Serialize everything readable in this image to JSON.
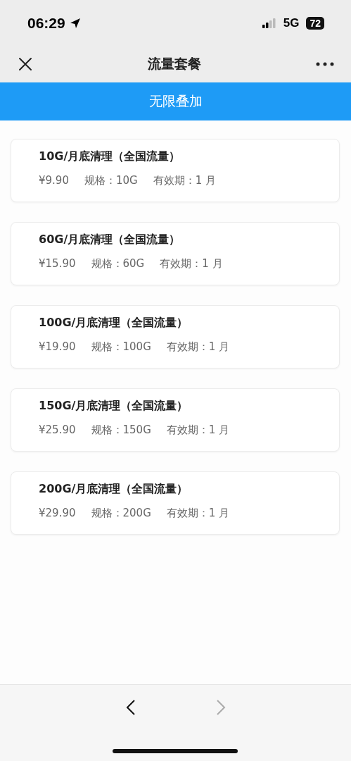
{
  "status_bar": {
    "time": "06:29",
    "network": "5G",
    "battery": "72"
  },
  "nav_bar": {
    "title": "流量套餐"
  },
  "banner": {
    "label": "无限叠加"
  },
  "plans": [
    {
      "title": "10G/月底清理（全国流量）",
      "price": "¥9.90",
      "spec": "规格：10G",
      "validity": "有效期：1 月"
    },
    {
      "title": "60G/月底清理（全国流量）",
      "price": "¥15.90",
      "spec": "规格：60G",
      "validity": "有效期：1 月"
    },
    {
      "title": "100G/月底清理（全国流量）",
      "price": "¥19.90",
      "spec": "规格：100G",
      "validity": "有效期：1 月"
    },
    {
      "title": "150G/月底清理（全国流量）",
      "price": "¥25.90",
      "spec": "规格：150G",
      "validity": "有效期：1 月"
    },
    {
      "title": "200G/月底清理（全国流量）",
      "price": "¥29.90",
      "spec": "规格：200G",
      "validity": "有效期：1 月"
    }
  ],
  "bottom_nav": {
    "back": {
      "disabled": false
    },
    "forward": {
      "disabled": true
    }
  }
}
